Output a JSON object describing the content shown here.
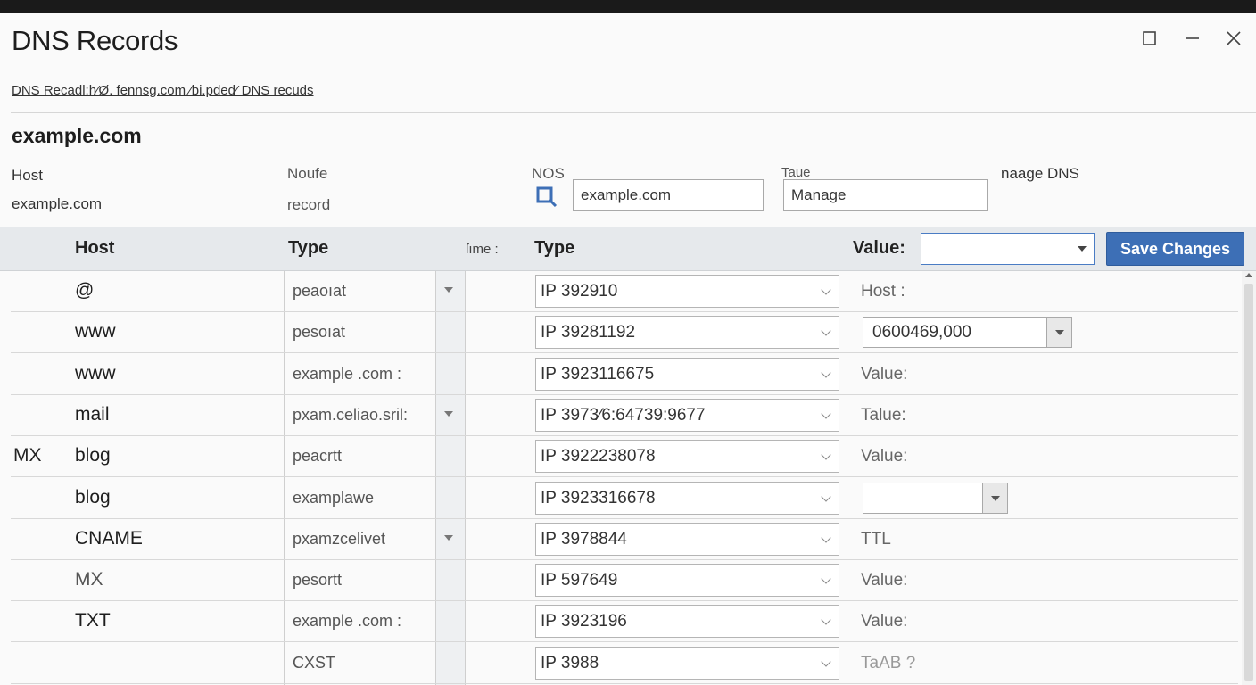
{
  "window": {
    "title": "DNS Records",
    "controls": {
      "maximize_icon": "maximize-icon",
      "minimize_icon": "minimize-icon",
      "close_icon": "close-icon"
    }
  },
  "breadcrumb": "DNS Recadl:h⁄Ø. fennsg.com ⁄bi.pded⁄ DNS recuds",
  "domain": "example.com",
  "info": {
    "host_label": "Host",
    "host_value": "example.com",
    "noufe_label": "Noufe",
    "noufe_value": "record",
    "nos_label": "NOS",
    "nos_input": "example.com",
    "taue_label": "Taue",
    "taue_input": "Manage",
    "manage_label": "naage DNS"
  },
  "table": {
    "headers": {
      "host": "Host",
      "type": "Type",
      "time": "ſıme :",
      "type2": "Type",
      "value": "Value:"
    },
    "save_button": "Save Changes",
    "rows": [
      {
        "prefix": "",
        "host": "@",
        "type": "peaoıat",
        "has_drop": true,
        "ip": "IP 392910",
        "value": "Host :",
        "value_kind": "text"
      },
      {
        "prefix": "",
        "host": "www",
        "type": "pesoıat",
        "has_drop": false,
        "ip": "IP 39281192",
        "value": "0600469,000",
        "value_kind": "select"
      },
      {
        "prefix": "",
        "host": "www",
        "type": "example .com :",
        "has_drop": false,
        "ip": "IP 3923116675",
        "value": "Value:",
        "value_kind": "text"
      },
      {
        "prefix": "",
        "host": "mail",
        "type": "pxam.celiao.sril:",
        "has_drop": true,
        "ip": "IP 3973⁄6:64739:9677",
        "value": "Talue:",
        "value_kind": "text"
      },
      {
        "prefix": "MX",
        "host": "blog",
        "type": "peacrtt",
        "has_drop": false,
        "ip": "IP 3922238078",
        "value": "Value:",
        "value_kind": "text"
      },
      {
        "prefix": "",
        "host": "blog",
        "type": "examplawe",
        "has_drop": false,
        "ip": "IP 3923316678",
        "value": "",
        "value_kind": "select-small"
      },
      {
        "prefix": "",
        "host": "CNAME",
        "type": "pxamzcelivet",
        "has_drop": true,
        "ip": "IP 3978844",
        "value": "TTL",
        "value_kind": "text"
      },
      {
        "prefix": "",
        "host": "MX",
        "type": "pesortt",
        "has_drop": false,
        "ip": "IP 597649",
        "value": "Value:",
        "value_kind": "text"
      },
      {
        "prefix": "",
        "host": "TXT",
        "type": "example .com :",
        "has_drop": false,
        "ip": "IP 3923196",
        "value": "Value:",
        "value_kind": "text"
      },
      {
        "prefix": "",
        "host": "",
        "type": "CXST",
        "has_drop": false,
        "ip": "IP 3988",
        "value": "TaAB ?",
        "value_kind": "faint"
      }
    ]
  },
  "colors": {
    "accent": "#3d6fb6",
    "header_bg": "#e6e9ec"
  }
}
